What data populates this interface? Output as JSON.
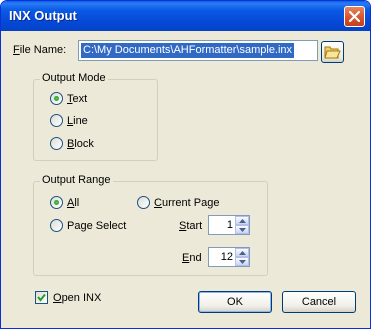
{
  "window": {
    "title": "INX Output"
  },
  "file": {
    "label": "File Name:",
    "value": "C:\\My Documents\\AHFormatter\\sample.inx"
  },
  "output_mode": {
    "title": "Output Mode",
    "options": [
      {
        "label": "Text",
        "selected": true
      },
      {
        "label": "Line",
        "selected": false
      },
      {
        "label": "Block",
        "selected": false
      }
    ]
  },
  "output_range": {
    "title": "Output Range",
    "all_label": "All",
    "current_page_label": "Current Page",
    "page_select_label": "Page Select",
    "selected": "All",
    "start": {
      "label": "Start",
      "value": "1"
    },
    "end": {
      "label": "End",
      "value": "12"
    }
  },
  "open_inx": {
    "label": "Open INX",
    "checked": true
  },
  "buttons": {
    "ok": "OK",
    "cancel": "Cancel"
  },
  "colors": {
    "titlebar": "#0a5be6",
    "selection": "#316ac5",
    "dialog_bg": "#ece9d8"
  },
  "icons": {
    "close": "close-icon",
    "browse": "folder-open-icon"
  }
}
